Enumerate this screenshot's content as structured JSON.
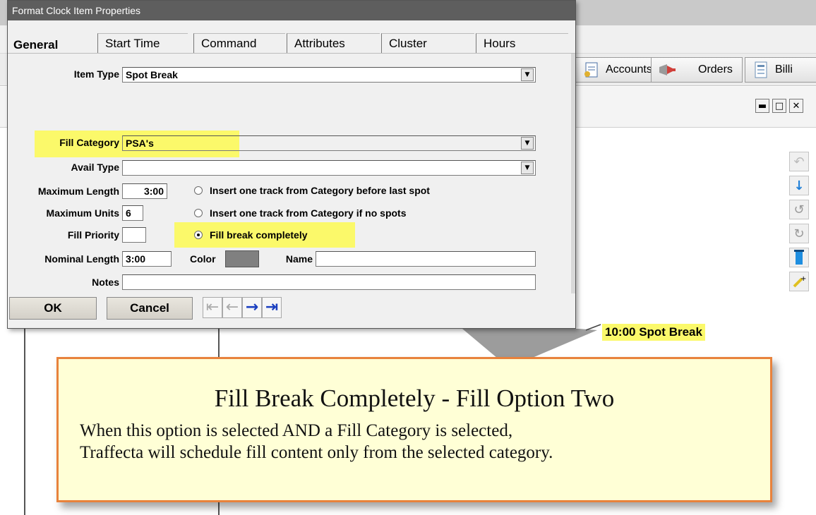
{
  "dialog": {
    "title": "Format Clock Item Properties",
    "tabs": [
      "General",
      "Start Time",
      "Command",
      "Attributes",
      "Cluster",
      "Hours"
    ],
    "active_tab": "General",
    "item_type_label": "Item Type",
    "item_type_value": "Spot Break",
    "fill_category_label": "Fill Category",
    "fill_category_value": "PSA's",
    "avail_type_label": "Avail Type",
    "avail_type_value": "",
    "max_length_label": "Maximum Length",
    "max_length_value": "3:00",
    "max_units_label": "Maximum Units",
    "max_units_value": "6",
    "fill_priority_label": "Fill Priority",
    "fill_priority_value": "",
    "nominal_length_label": "Nominal Length",
    "nominal_length_value": "3:00",
    "color_label": "Color",
    "color_value": "#808080",
    "name_label": "Name",
    "name_value": "",
    "notes_label": "Notes",
    "notes_value": "",
    "options": [
      {
        "label": "Insert one track from Category before last spot",
        "selected": false
      },
      {
        "label": "Insert one track from Category if no spots",
        "selected": false
      },
      {
        "label": "Fill break completely",
        "selected": true
      }
    ],
    "ok_label": "OK",
    "cancel_label": "Cancel",
    "nav_icons": [
      "first-record-icon",
      "previous-record-icon",
      "next-record-icon",
      "last-record-icon"
    ]
  },
  "toolbar": {
    "items": [
      {
        "label": "Accounts",
        "icon": "accounts-icon"
      },
      {
        "label": "Orders",
        "icon": "orders-icon"
      },
      {
        "label": "Billi",
        "icon": "billing-icon"
      }
    ]
  },
  "window_controls": [
    "minimize-icon",
    "restore-icon",
    "close-icon"
  ],
  "callout": {
    "label": "10:00 Spot Break",
    "title": "Fill Break Completely - Fill Option Two",
    "body_line1": "When this option is selected AND a Fill Category is selected,",
    "body_line2": "Traffecta will schedule fill content only from the selected category."
  },
  "colors": {
    "highlight": "#fbf96a",
    "callout_border": "#e8823c",
    "callout_fill": "#ffffd6",
    "dialog_title_bar": "#5e5e5e"
  }
}
